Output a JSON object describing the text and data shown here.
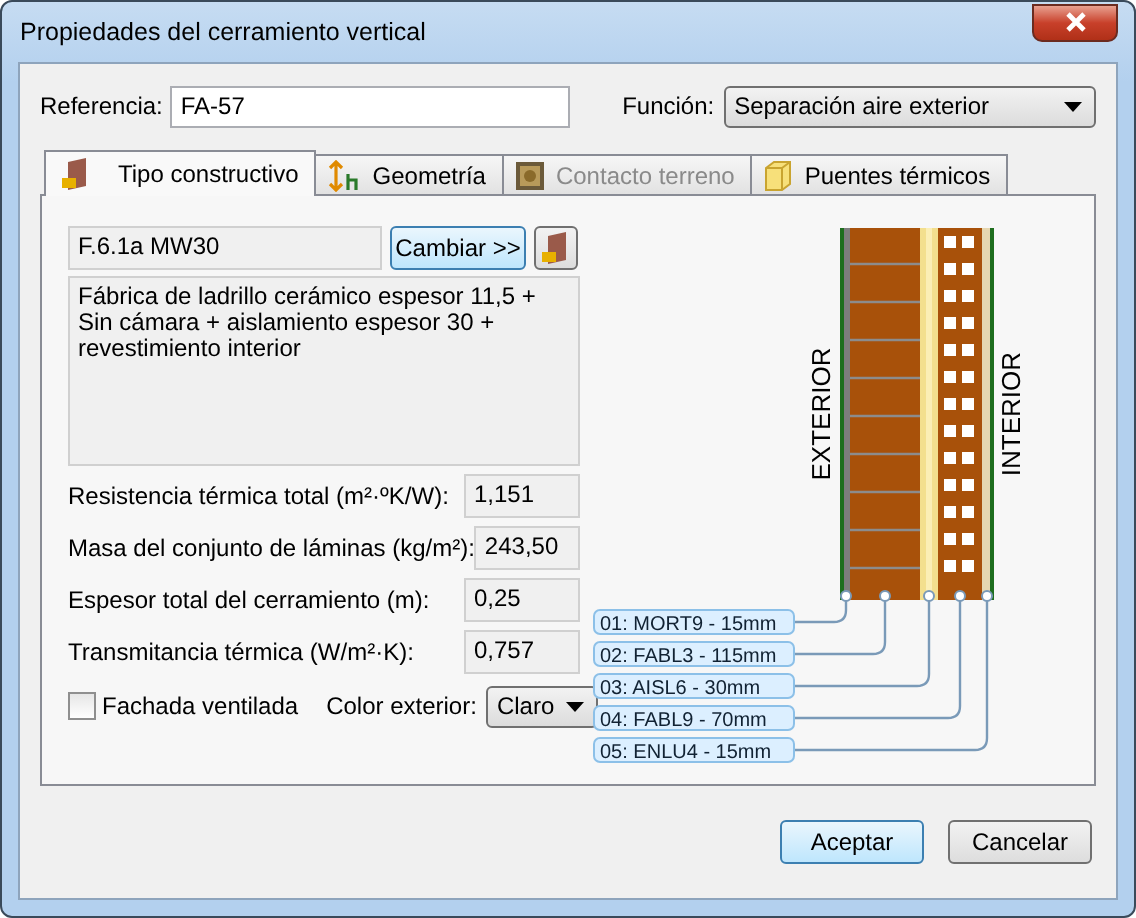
{
  "window": {
    "title": "Propiedades del cerramiento vertical"
  },
  "reference": {
    "label": "Referencia:",
    "value": "FA-57"
  },
  "function": {
    "label": "Función:",
    "value": "Separación aire exterior"
  },
  "tabs": [
    {
      "label": "Tipo constructivo",
      "kind": "wall",
      "selected": true,
      "disabled": false
    },
    {
      "label": "Geometría",
      "kind": "height",
      "selected": false,
      "disabled": false
    },
    {
      "label": "Contacto terreno",
      "kind": "ground",
      "selected": false,
      "disabled": true
    },
    {
      "label": "Puentes térmicos",
      "kind": "bridge",
      "selected": false,
      "disabled": false
    }
  ],
  "construction": {
    "code": "F.6.1a MW30",
    "change_button": "Cambiar >>",
    "description": "Fábrica de ladrillo cerámico espesor 11,5 + Sin cámara + aislamiento espesor 30 + revestimiento interior"
  },
  "properties": [
    {
      "label": "Resistencia térmica total  (m²·ºK/W):",
      "value": "1,151"
    },
    {
      "label": "Masa del conjunto de láminas (kg/m²):",
      "value": "243,50"
    },
    {
      "label": "Espesor total del cerramiento (m):",
      "value": "0,25"
    },
    {
      "label": "Transmitancia térmica (W/m²·K):",
      "value": "0,757"
    }
  ],
  "ventilated_facade": {
    "label": "Fachada ventilada",
    "checked": false
  },
  "exterior_color": {
    "label": "Color exterior:",
    "value": "Claro"
  },
  "diagram": {
    "exterior_label": "EXTERIOR",
    "interior_label": "INTERIOR",
    "layers": [
      {
        "label": "01: MORT9 - 15mm",
        "kind": "mortar"
      },
      {
        "label": "02: FABL3 - 115mm",
        "kind": "brick"
      },
      {
        "label": "03: AISL6 - 30mm",
        "kind": "insulation"
      },
      {
        "label": "04: FABL9 - 70mm",
        "kind": "hollow-brick"
      },
      {
        "label": "05: ENLU4 - 15mm",
        "kind": "plaster"
      }
    ]
  },
  "buttons": [
    {
      "label": "Aceptar",
      "default": true
    },
    {
      "label": "Cancelar",
      "default": false
    }
  ]
}
